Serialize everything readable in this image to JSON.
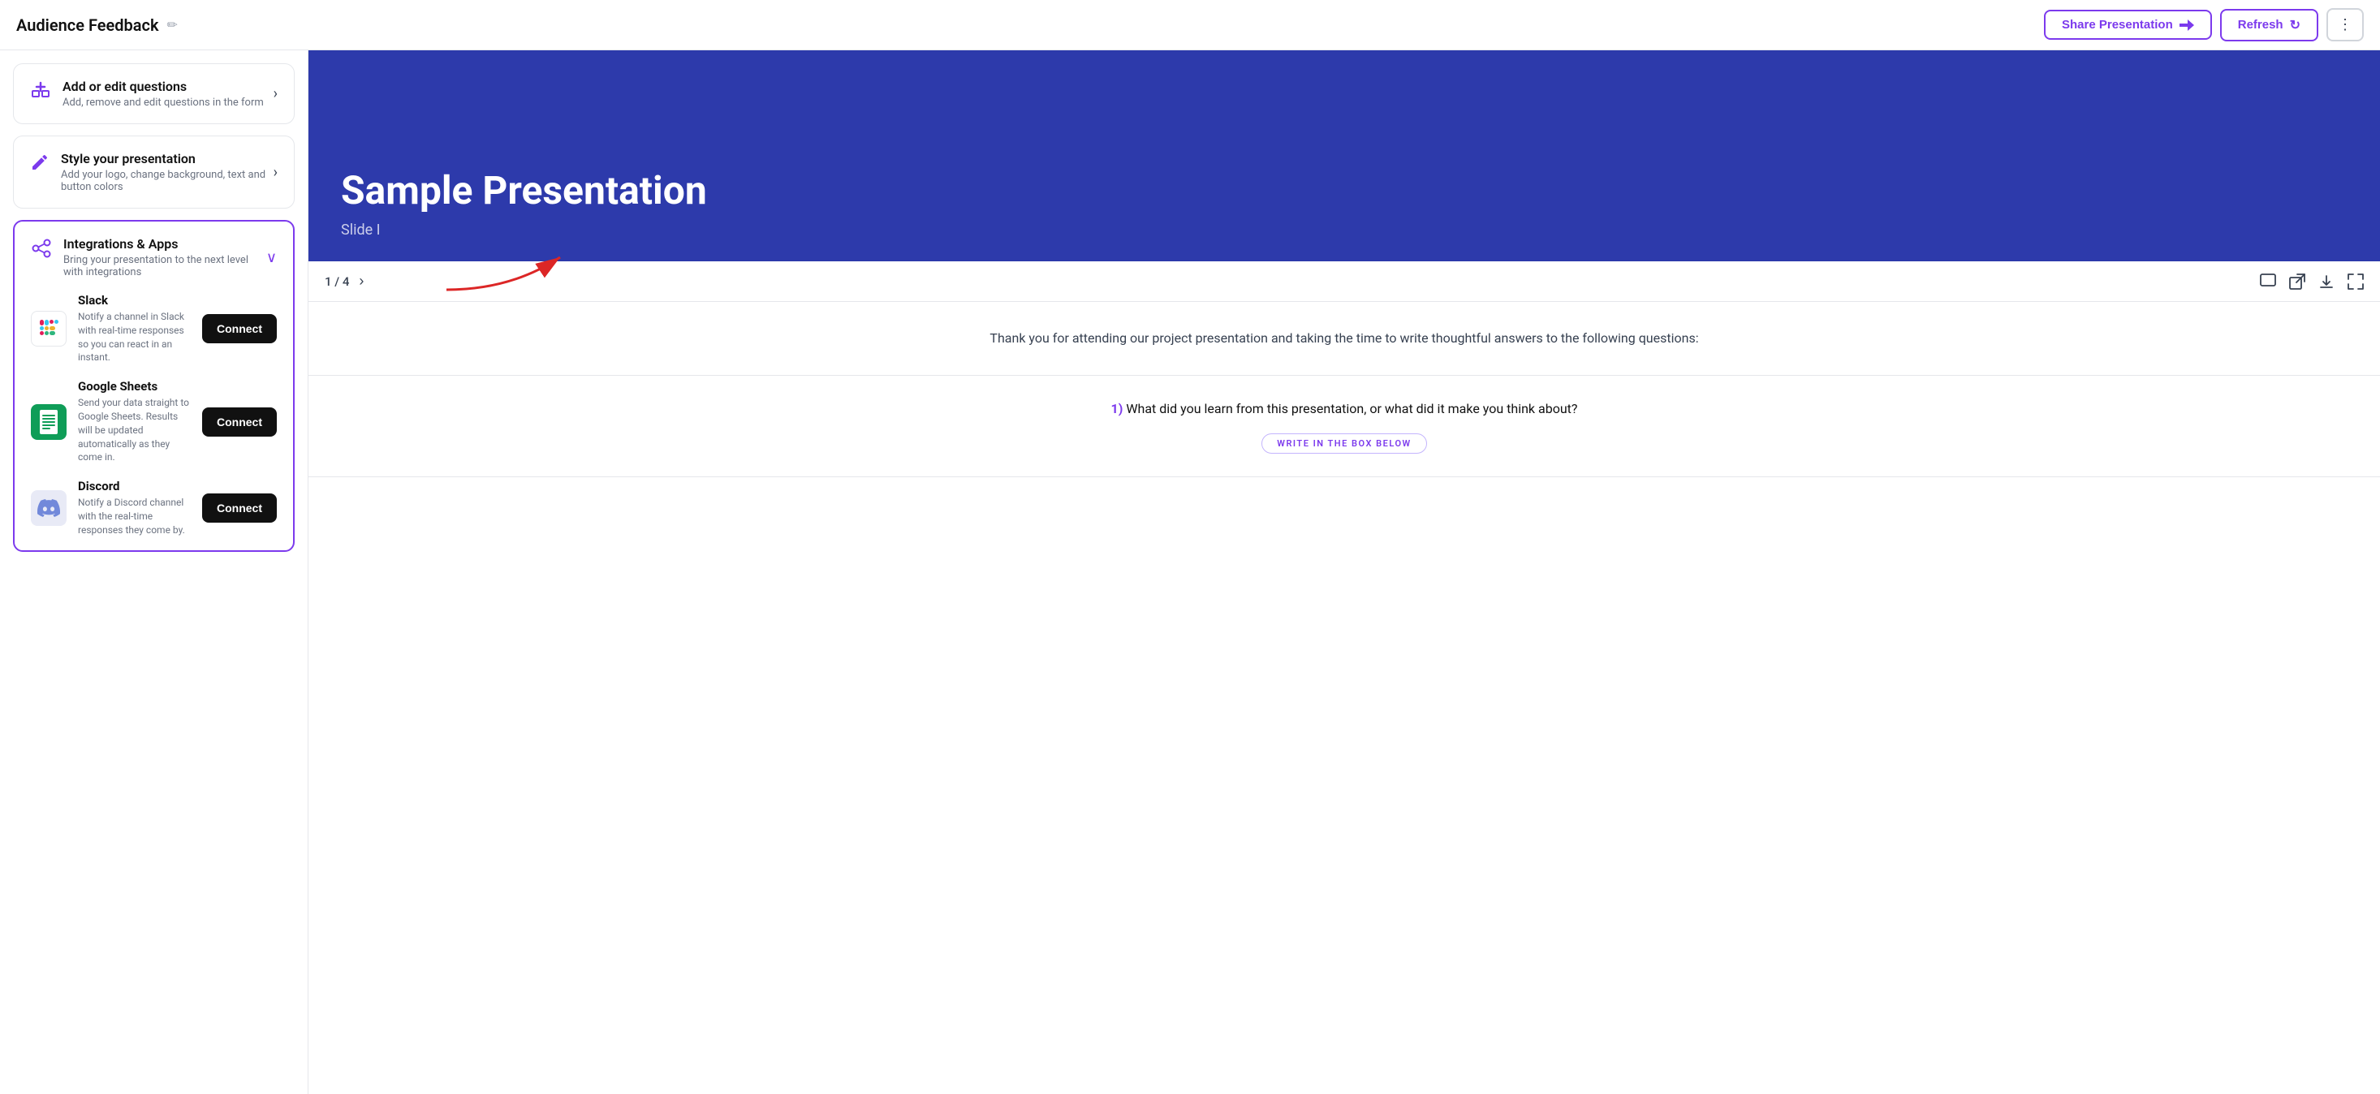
{
  "header": {
    "title": "Audience Feedback",
    "edit_icon": "✏",
    "share_label": "Share Presentation",
    "refresh_label": "Refresh",
    "more_icon": "⋮"
  },
  "left_panel": {
    "cards": [
      {
        "id": "add-edit-questions",
        "icon": "⊞",
        "title": "Add or edit questions",
        "desc": "Add, remove and edit questions in the form"
      },
      {
        "id": "style-presentation",
        "icon": "✏",
        "title": "Style your presentation",
        "desc": "Add your logo, change background, text and button colors"
      }
    ],
    "integrations": {
      "title": "Integrations & Apps",
      "desc": "Bring your presentation to the next level with integrations",
      "expanded": true,
      "items": [
        {
          "id": "slack",
          "name": "Slack",
          "desc": "Notify a channel in Slack with real-time responses so you can react in an instant.",
          "connect_label": "Connect"
        },
        {
          "id": "google-sheets",
          "name": "Google Sheets",
          "desc": "Send your data straight to Google Sheets. Results will be updated automatically as they come in.",
          "connect_label": "Connect"
        },
        {
          "id": "discord",
          "name": "Discord",
          "desc": "Notify a Discord channel with the real-time responses they come by.",
          "connect_label": "Connect"
        }
      ]
    }
  },
  "right_panel": {
    "slide": {
      "title": "Sample Presentation",
      "subtitle": "Slide I"
    },
    "controls": {
      "current": "1",
      "total": "4",
      "nav_label": "1 / 4"
    },
    "form": {
      "intro": "Thank you for attending our project presentation and taking the time to\nwrite thoughtful answers to the following questions:",
      "question_number": "1)",
      "question_text": "What did you learn from this presentation, or what did it make you think about?",
      "write_in_label": "WRITE IN THE BOX BELOW"
    }
  },
  "colors": {
    "purple": "#7c3aed",
    "slide_bg": "#2d3aab",
    "black": "#111111",
    "red": "#dc2626"
  }
}
